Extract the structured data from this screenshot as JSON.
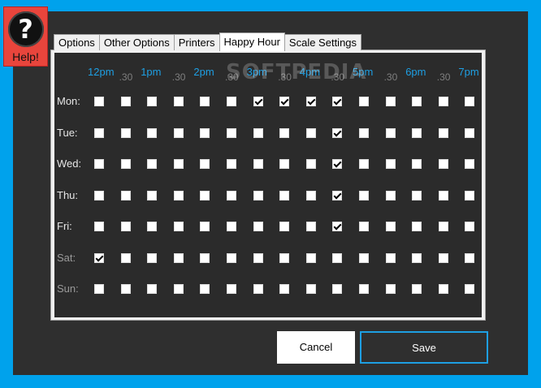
{
  "help": {
    "label": "Help!",
    "glyph": "?"
  },
  "tabs": [
    {
      "label": "Options",
      "active": false
    },
    {
      "label": "Other Options",
      "active": false
    },
    {
      "label": "Printers",
      "active": false
    },
    {
      "label": "Happy Hour",
      "active": true
    },
    {
      "label": "Scale Settings",
      "active": false
    }
  ],
  "watermark": "SOFTPEDIA",
  "time_slots": [
    "12pm",
    ".30",
    "1pm",
    ".30",
    "2pm",
    ".30",
    "3pm",
    ".30",
    "4pm",
    ".30",
    "5pm",
    ".30",
    "6pm",
    ".30",
    "7pm"
  ],
  "days": [
    {
      "label": "Mon:",
      "checked": [
        6,
        7,
        8,
        9
      ]
    },
    {
      "label": "Tue:",
      "checked": [
        9
      ]
    },
    {
      "label": "Wed:",
      "checked": [
        9
      ]
    },
    {
      "label": "Thu:",
      "checked": [
        9
      ]
    },
    {
      "label": "Fri:",
      "checked": [
        9
      ]
    },
    {
      "label": "Sat:",
      "checked": [
        0
      ]
    },
    {
      "label": "Sun:",
      "checked": []
    }
  ],
  "buttons": {
    "cancel": "Cancel",
    "save": "Save"
  },
  "colors": {
    "accent": "#1e9fe3",
    "background": "#00a2ec",
    "panel": "#2b2b2b",
    "help": "#e8453c"
  }
}
